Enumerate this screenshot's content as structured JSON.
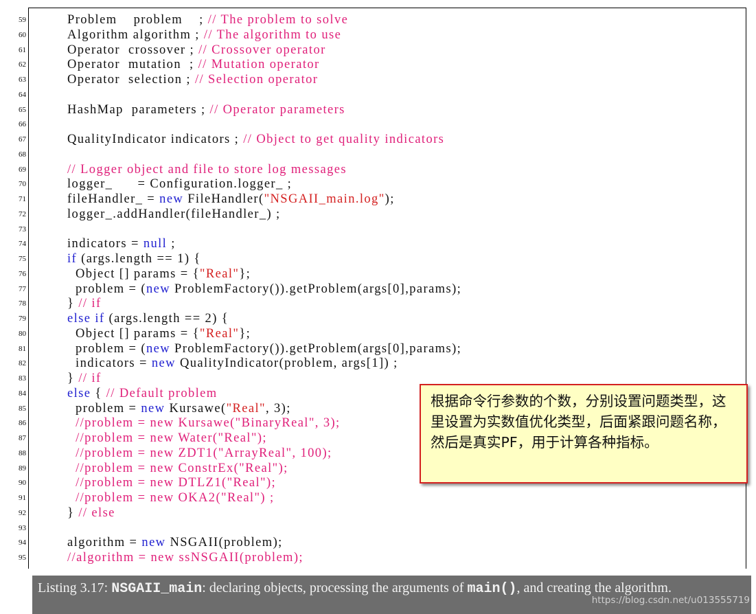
{
  "listing": {
    "lines": [
      {
        "n": "59",
        "segs": [
          [
            "pl",
            "Problem    problem    ; "
          ],
          [
            "c",
            "// The problem to solve"
          ]
        ]
      },
      {
        "n": "60",
        "segs": [
          [
            "pl",
            "Algorithm algorithm ; "
          ],
          [
            "c",
            "// The algorithm to use"
          ]
        ]
      },
      {
        "n": "61",
        "segs": [
          [
            "pl",
            "Operator  crossover ; "
          ],
          [
            "c",
            "// Crossover operator"
          ]
        ]
      },
      {
        "n": "62",
        "segs": [
          [
            "pl",
            "Operator  mutation  ; "
          ],
          [
            "c",
            "// Mutation operator"
          ]
        ]
      },
      {
        "n": "63",
        "segs": [
          [
            "pl",
            "Operator  selection ; "
          ],
          [
            "c",
            "// Selection operator"
          ]
        ]
      },
      {
        "n": "64",
        "segs": []
      },
      {
        "n": "65",
        "segs": [
          [
            "pl",
            "HashMap  parameters ; "
          ],
          [
            "c",
            "// Operator parameters"
          ]
        ]
      },
      {
        "n": "66",
        "segs": []
      },
      {
        "n": "67",
        "segs": [
          [
            "pl",
            "QualityIndicator indicators ; "
          ],
          [
            "c",
            "// Object to get quality indicators"
          ]
        ]
      },
      {
        "n": "68",
        "segs": []
      },
      {
        "n": "69",
        "segs": [
          [
            "c",
            "// Logger object and file to store log messages"
          ]
        ]
      },
      {
        "n": "70",
        "segs": [
          [
            "pl",
            "logger_      = Configuration.logger_ ;"
          ]
        ]
      },
      {
        "n": "71",
        "segs": [
          [
            "pl",
            "fileHandler_ = "
          ],
          [
            "k",
            "new"
          ],
          [
            "pl",
            " FileHandler("
          ],
          [
            "s",
            "\"NSGAII_main.log\""
          ],
          [
            "pl",
            ");"
          ]
        ]
      },
      {
        "n": "72",
        "segs": [
          [
            "pl",
            "logger_.addHandler(fileHandler_) ;"
          ]
        ]
      },
      {
        "n": "73",
        "segs": []
      },
      {
        "n": "74",
        "segs": [
          [
            "pl",
            "indicators = "
          ],
          [
            "k",
            "null"
          ],
          [
            "pl",
            " ;"
          ]
        ]
      },
      {
        "n": "75",
        "segs": [
          [
            "k",
            "if"
          ],
          [
            "pl",
            " (args.length == 1) {"
          ]
        ]
      },
      {
        "n": "76",
        "segs": [
          [
            "pl",
            "  Object [] params = {"
          ],
          [
            "s",
            "\"Real\""
          ],
          [
            "pl",
            "};"
          ]
        ]
      },
      {
        "n": "77",
        "segs": [
          [
            "pl",
            "  problem = ("
          ],
          [
            "k",
            "new"
          ],
          [
            "pl",
            " ProblemFactory()).getProblem(args[0],params);"
          ]
        ]
      },
      {
        "n": "78",
        "segs": [
          [
            "pl",
            "} "
          ],
          [
            "c",
            "// if"
          ]
        ]
      },
      {
        "n": "79",
        "segs": [
          [
            "k",
            "else if"
          ],
          [
            "pl",
            " (args.length == 2) {"
          ]
        ]
      },
      {
        "n": "80",
        "segs": [
          [
            "pl",
            "  Object [] params = {"
          ],
          [
            "s",
            "\"Real\""
          ],
          [
            "pl",
            "};"
          ]
        ]
      },
      {
        "n": "81",
        "segs": [
          [
            "pl",
            "  problem = ("
          ],
          [
            "k",
            "new"
          ],
          [
            "pl",
            " ProblemFactory()).getProblem(args[0],params);"
          ]
        ]
      },
      {
        "n": "82",
        "segs": [
          [
            "pl",
            "  indicators = "
          ],
          [
            "k",
            "new"
          ],
          [
            "pl",
            " QualityIndicator(problem, args[1]) ;"
          ]
        ]
      },
      {
        "n": "83",
        "segs": [
          [
            "pl",
            "} "
          ],
          [
            "c",
            "// if"
          ]
        ]
      },
      {
        "n": "84",
        "segs": [
          [
            "k",
            "else"
          ],
          [
            "pl",
            " { "
          ],
          [
            "c",
            "// Default problem"
          ]
        ]
      },
      {
        "n": "85",
        "segs": [
          [
            "pl",
            "  problem = "
          ],
          [
            "k",
            "new"
          ],
          [
            "pl",
            " Kursawe("
          ],
          [
            "s",
            "\"Real\""
          ],
          [
            "pl",
            ", 3);"
          ]
        ]
      },
      {
        "n": "86",
        "segs": [
          [
            "pl",
            "  "
          ],
          [
            "c",
            "//problem = new Kursawe(\"BinaryReal\", 3);"
          ]
        ]
      },
      {
        "n": "87",
        "segs": [
          [
            "pl",
            "  "
          ],
          [
            "c",
            "//problem = new Water(\"Real\");"
          ]
        ]
      },
      {
        "n": "88",
        "segs": [
          [
            "pl",
            "  "
          ],
          [
            "c",
            "//problem = new ZDT1(\"ArrayReal\", 100);"
          ]
        ]
      },
      {
        "n": "89",
        "segs": [
          [
            "pl",
            "  "
          ],
          [
            "c",
            "//problem = new ConstrEx(\"Real\");"
          ]
        ]
      },
      {
        "n": "90",
        "segs": [
          [
            "pl",
            "  "
          ],
          [
            "c",
            "//problem = new DTLZ1(\"Real\");"
          ]
        ]
      },
      {
        "n": "91",
        "segs": [
          [
            "pl",
            "  "
          ],
          [
            "c",
            "//problem = new OKA2(\"Real\") ;"
          ]
        ]
      },
      {
        "n": "92",
        "segs": [
          [
            "pl",
            "} "
          ],
          [
            "c",
            "// else"
          ]
        ]
      },
      {
        "n": "93",
        "segs": []
      },
      {
        "n": "94",
        "segs": [
          [
            "pl",
            "algorithm = "
          ],
          [
            "k",
            "new"
          ],
          [
            "pl",
            " NSGAII(problem);"
          ]
        ]
      },
      {
        "n": "95",
        "segs": [
          [
            "c",
            "//algorithm = new ssNSGAII(problem);"
          ]
        ]
      }
    ]
  },
  "note": {
    "text": "根据命令行参数的个数，分别设置问题类型，这里设置为实数值优化类型，后面紧跟问题名称，然后是真实PF，用于计算各种指标。"
  },
  "caption": {
    "prefix": "Listing 3.17: ",
    "name": "NSGAII_main",
    "middle": ": declaring objects, processing the arguments of ",
    "method": "main()",
    "suffix": ", and creating the algorithm."
  },
  "watermark": "https://blog.csdn.net/u013555719",
  "colors": {
    "keyword": "#1f1fd0",
    "comment": "#e0207a",
    "string": "#d42020",
    "note_bg": "#ffffc4",
    "note_border": "#d42020",
    "caption_bg": "#6d6d6d"
  }
}
